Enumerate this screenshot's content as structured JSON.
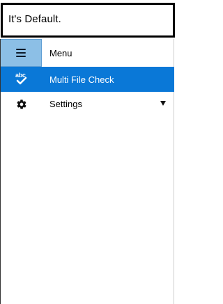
{
  "header": {
    "text": "It's Default."
  },
  "menu": {
    "toggle_label": "Menu",
    "items": [
      {
        "label": "Multi File Check",
        "icon": "spellcheck-abc-icon",
        "selected": true
      },
      {
        "label": "Settings",
        "icon": "gear-icon",
        "selected": false,
        "has_dropdown": true
      }
    ]
  },
  "colors": {
    "selected_bg": "#0a78d7",
    "toggle_bg": "#8cbfe6",
    "selected_text": "#ffffff"
  }
}
